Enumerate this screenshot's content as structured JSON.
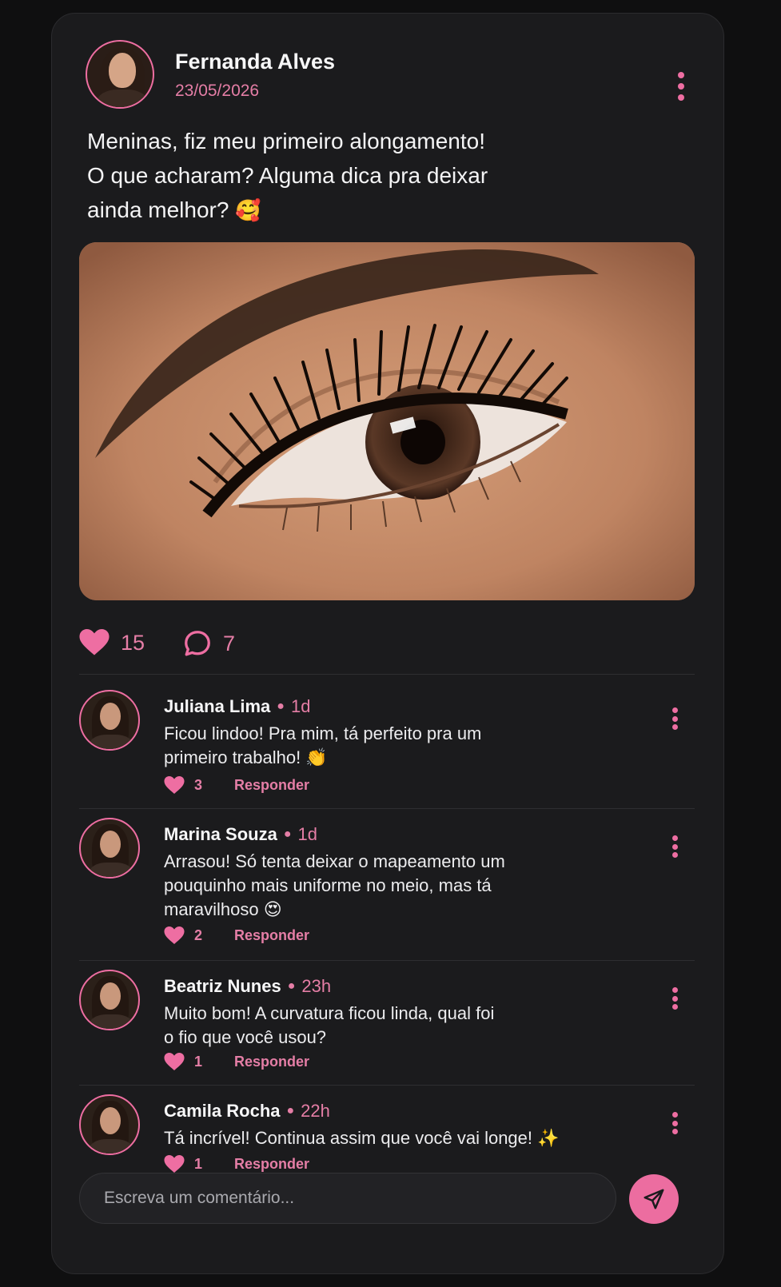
{
  "post": {
    "author": "Fernanda Alves",
    "date": "23/05/2026",
    "text": "Meninas, fiz meu primeiro alongamento!\nO que acharam? Alguma dica pra deixar\nainda melhor?",
    "text_emoji": "🥰",
    "likes": "15",
    "comments": "7"
  },
  "comments": [
    {
      "name": "Juliana Lima",
      "time": "1d",
      "text": "Ficou lindoo! Pra mim, tá perfeito pra um\nprimeiro trabalho!",
      "emoji": "👏",
      "likes": "3",
      "reply": "Responder"
    },
    {
      "name": "Marina Souza",
      "time": "1d",
      "text": "Arrasou! Só tenta deixar o mapeamento um\npouquinho mais uniforme no meio, mas tá\nmaravilhoso",
      "emoji": "😍",
      "likes": "2",
      "reply": "Responder"
    },
    {
      "name": "Beatriz Nunes",
      "time": "23h",
      "text": "Muito bom! A curvatura ficou linda, qual foi\no fio que você usou?",
      "emoji": "",
      "likes": "1",
      "reply": "Responder"
    },
    {
      "name": "Camila Rocha",
      "time": "22h",
      "text": "Tá incrível! Continua assim que você vai longe!",
      "emoji": "✨",
      "likes": "1",
      "reply": "Responder"
    }
  ],
  "composer": {
    "placeholder": "Escreva um comentário..."
  },
  "colors": {
    "accent": "#ec6da0",
    "card": "#1b1b1d",
    "background": "#0f0f10"
  },
  "icons": [
    "kebab-menu-icon",
    "heart-icon",
    "comment-bubble-icon",
    "send-icon"
  ]
}
